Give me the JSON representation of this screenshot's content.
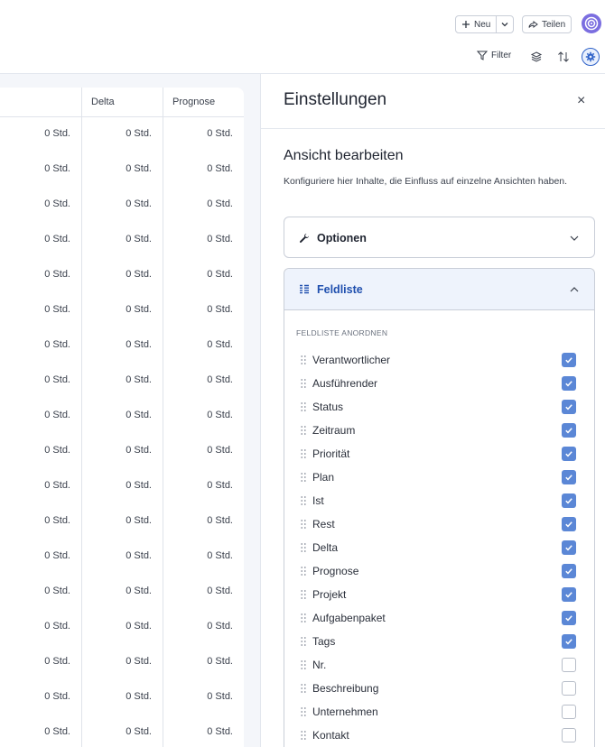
{
  "toolbar": {
    "new_label": "Neu",
    "share_label": "Teilen",
    "filter_label": "Filter",
    "icons": [
      "plus-icon",
      "chevron-down-icon",
      "share-icon",
      "filter-icon",
      "layers-icon",
      "sort-icon",
      "gear-icon"
    ]
  },
  "table": {
    "columns": [
      "",
      "Delta",
      "Prognose"
    ],
    "rows": [
      [
        "0 Std.",
        "0 Std.",
        "0 Std."
      ],
      [
        "0 Std.",
        "0 Std.",
        "0 Std."
      ],
      [
        "0 Std.",
        "0 Std.",
        "0 Std."
      ],
      [
        "0 Std.",
        "0 Std.",
        "0 Std."
      ],
      [
        "0 Std.",
        "0 Std.",
        "0 Std."
      ],
      [
        "0 Std.",
        "0 Std.",
        "0 Std."
      ],
      [
        "0 Std.",
        "0 Std.",
        "0 Std."
      ],
      [
        "0 Std.",
        "0 Std.",
        "0 Std."
      ],
      [
        "0 Std.",
        "0 Std.",
        "0 Std."
      ],
      [
        "0 Std.",
        "0 Std.",
        "0 Std."
      ],
      [
        "0 Std.",
        "0 Std.",
        "0 Std."
      ],
      [
        "0 Std.",
        "0 Std.",
        "0 Std."
      ],
      [
        "0 Std.",
        "0 Std.",
        "0 Std."
      ],
      [
        "0 Std.",
        "0 Std.",
        "0 Std."
      ],
      [
        "0 Std.",
        "0 Std.",
        "0 Std."
      ],
      [
        "0 Std.",
        "0 Std.",
        "0 Std."
      ],
      [
        "0 Std.",
        "0 Std.",
        "0 Std."
      ],
      [
        "0 Std.",
        "0 Std.",
        "0 Std."
      ]
    ]
  },
  "panel": {
    "title": "Einstellungen",
    "close": "×",
    "section_title": "Ansicht bearbeiten",
    "section_desc": "Konfiguriere hier Inhalte, die Einfluss auf einzelne Ansichten haben.",
    "options_label": "Optionen",
    "fieldlist_label": "Feldliste",
    "fieldlist_caption": "FELDLISTE ANORDNEN",
    "fields": [
      {
        "label": "Verantwortlicher",
        "checked": true
      },
      {
        "label": "Ausführender",
        "checked": true
      },
      {
        "label": "Status",
        "checked": true
      },
      {
        "label": "Zeitraum",
        "checked": true
      },
      {
        "label": "Priorität",
        "checked": true
      },
      {
        "label": "Plan",
        "checked": true
      },
      {
        "label": "Ist",
        "checked": true
      },
      {
        "label": "Rest",
        "checked": true
      },
      {
        "label": "Delta",
        "checked": true
      },
      {
        "label": "Prognose",
        "checked": true
      },
      {
        "label": "Projekt",
        "checked": true
      },
      {
        "label": "Aufgabenpaket",
        "checked": true
      },
      {
        "label": "Tags",
        "checked": true
      },
      {
        "label": "Nr.",
        "checked": false
      },
      {
        "label": "Beschreibung",
        "checked": false
      },
      {
        "label": "Unternehmen",
        "checked": false
      },
      {
        "label": "Kontakt",
        "checked": false
      }
    ]
  },
  "colors": {
    "accent": "#2f62c8",
    "checkbox_on": "#5b87d6",
    "brand_logo": "#7b6ee0"
  }
}
